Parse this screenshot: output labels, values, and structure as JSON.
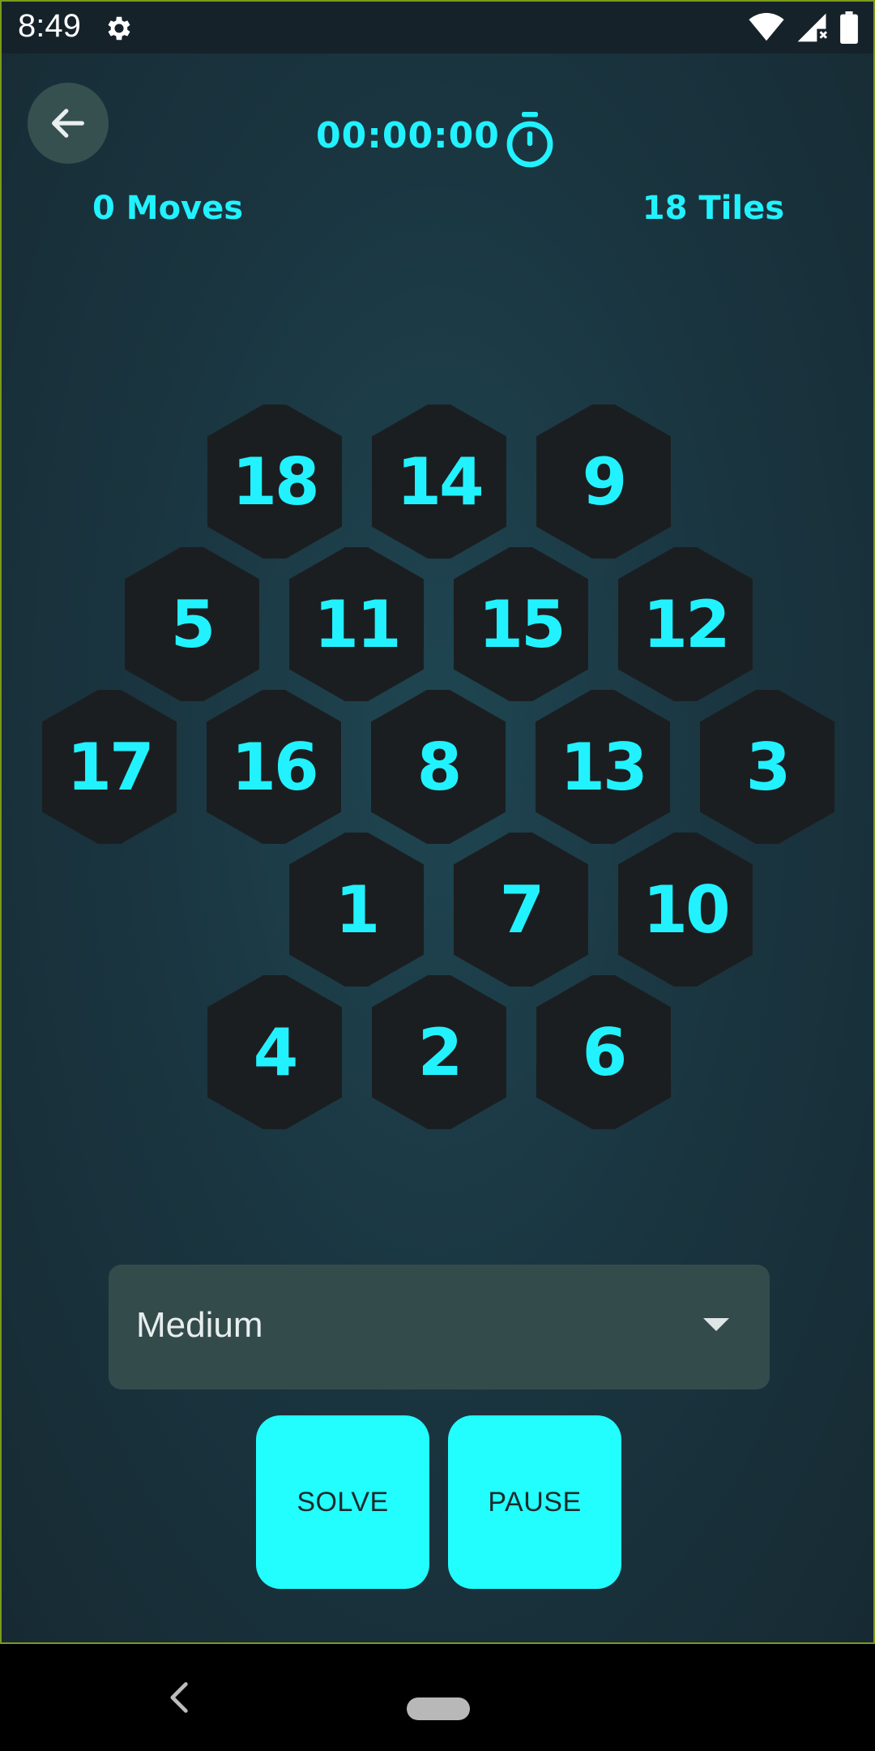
{
  "status_bar": {
    "time": "8:49",
    "icons": [
      "settings-gear-icon",
      "wifi-icon",
      "signal-icon",
      "battery-icon"
    ]
  },
  "header": {
    "back_icon": "arrow-left-icon",
    "timer": "00:00:00",
    "timer_icon": "stopwatch-icon",
    "moves": "0 Moves",
    "tiles": "18 Tiles"
  },
  "board": {
    "rows": [
      [
        "18",
        "14",
        "9"
      ],
      [
        "5",
        "11",
        "15",
        "12"
      ],
      [
        "17",
        "16",
        "8",
        "13",
        "3"
      ],
      [
        "",
        "1",
        "7",
        "10"
      ],
      [
        "4",
        "2",
        "6"
      ]
    ]
  },
  "controls": {
    "difficulty": "Medium",
    "solve_label": "SOLVE",
    "pause_label": "PAUSE"
  },
  "colors": {
    "accent": "#22f2ff",
    "tile": "#1b1e20",
    "button": "#22fdfd",
    "dropdown_bg": "#344b4c"
  },
  "navigation": {
    "back_icon": "nav-back-icon",
    "home_icon": "nav-home-pill"
  }
}
